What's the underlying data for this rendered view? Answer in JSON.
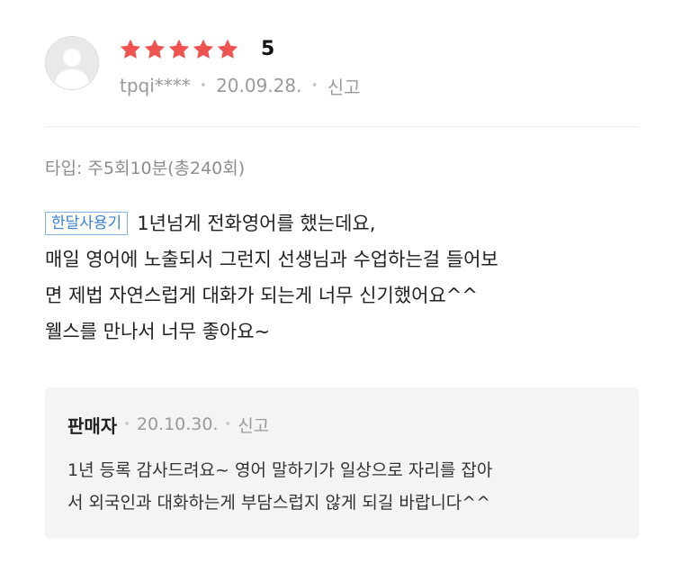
{
  "review": {
    "rating": {
      "value": 5,
      "max": 5,
      "score_label": "5",
      "star_color": "#ef5350"
    },
    "user": {
      "id": "tpqi****"
    },
    "date": "20.09.28.",
    "report_label": "신고",
    "type_text": "타입: 주5회10분(총240회)",
    "tag": "한달사용기",
    "lines": [
      "1년넘게 전화영어를 했는데요,",
      "매일 영어에 노출되서 그런지 선생님과  수업하는걸 들어보",
      "면 제법 자연스럽게 대화가 되는게 너무 신기했어요^^",
      "웰스를 만나서 너무 좋아요~"
    ]
  },
  "seller_reply": {
    "name": "판매자",
    "date": "20.10.30.",
    "report_label": "신고",
    "lines": [
      "1년 등록 감사드려요~ 영어 말하기가 일상으로 자리를 잡아",
      "서 외국인과 대화하는게 부담스럽지 않게 되길 바랍니다^^"
    ]
  },
  "icons": {
    "avatar": "user-silhouette-icon",
    "star": "star-icon",
    "separator": "dot-icon"
  },
  "colors": {
    "tag_border": "#7fb2e6",
    "tag_text": "#3c82d2",
    "reply_bg": "#f4f4f6"
  }
}
